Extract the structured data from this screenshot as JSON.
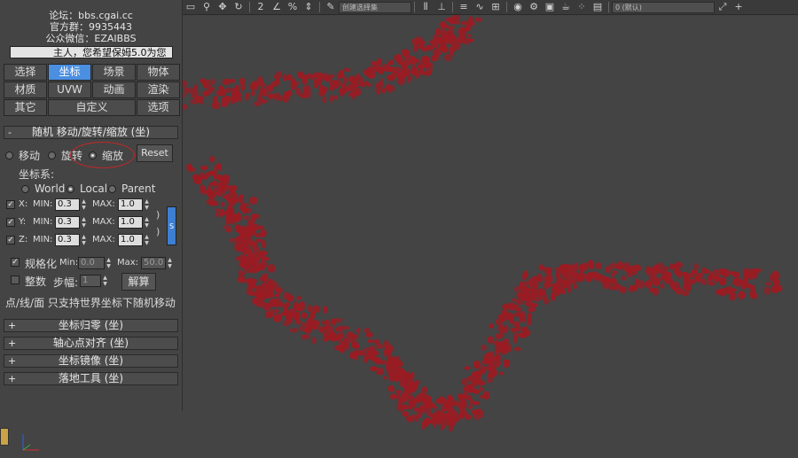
{
  "header": {
    "forum": "论坛：bbs.cgai.cc",
    "qq_group": "官方群：9935443",
    "wechat": "公众微信：EZAIBBS",
    "notice": "主人，您希望保姆5.0为您"
  },
  "tabs": [
    {
      "label": "选择",
      "active": false
    },
    {
      "label": "坐标",
      "active": true
    },
    {
      "label": "场景",
      "active": false
    },
    {
      "label": "物体",
      "active": false
    },
    {
      "label": "材质",
      "active": false
    },
    {
      "label": "UVW",
      "active": false
    },
    {
      "label": "动画",
      "active": false
    },
    {
      "label": "渲染",
      "active": false
    },
    {
      "label": "其它",
      "active": false
    },
    {
      "label": "自定义",
      "active": false
    },
    {
      "label": "选项",
      "active": false
    }
  ],
  "random_rollout": {
    "sign": "-",
    "title": "随机 移动/旋转/缩放 (坐)",
    "modes": [
      {
        "label": "移动",
        "selected": false
      },
      {
        "label": "旋转",
        "selected": false
      },
      {
        "label": "缩放",
        "selected": true
      }
    ],
    "reset_label": "Reset",
    "coord_label": "坐标系:",
    "coord_options": [
      {
        "label": "World",
        "selected": false
      },
      {
        "label": "Local",
        "selected": true
      },
      {
        "label": "Parent",
        "selected": false
      }
    ],
    "axes": [
      {
        "axis": "X:",
        "checked": true,
        "min_label": "MIN:",
        "min": "0.3",
        "max_label": "MAX:",
        "max": "1.0"
      },
      {
        "axis": "Y:",
        "checked": true,
        "min_label": "MIN:",
        "min": "0.3",
        "max_label": "MAX:",
        "max": "1.0"
      },
      {
        "axis": "Z:",
        "checked": true,
        "min_label": "MIN:",
        "min": "0.3",
        "max_label": "MAX:",
        "max": "1.0"
      }
    ],
    "side_button": "S",
    "normalize": {
      "label": "规格化",
      "checked": true,
      "min_label": "Min:",
      "min": "0.0",
      "max_label": "Max:",
      "max": "50.0"
    },
    "integer": {
      "label": "整数",
      "checked": false,
      "step_label": "步幅:",
      "step": "1"
    },
    "solve_label": "解算",
    "note": "点/线/面 只支持世界坐标下随机移动"
  },
  "other_rollouts": [
    {
      "sign": "+",
      "title": "坐标归零 (坐)"
    },
    {
      "sign": "+",
      "title": "轴心点对齐 (坐)"
    },
    {
      "sign": "+",
      "title": "坐标镜像 (坐)"
    },
    {
      "sign": "+",
      "title": "落地工具 (坐)"
    }
  ],
  "toolbar": {
    "selection_set_placeholder": "创建选择集",
    "layer_name": "0 (默认)",
    "icons": [
      "window-icon",
      "link-icon",
      "move-icon",
      "rotate-icon",
      "scale-icon",
      "snap-2-icon",
      "angle-snap-icon",
      "percent-snap-icon",
      "spinner-snap-icon",
      "edit-named-selection-icon",
      "mirror-icon",
      "align-icon",
      "layer-icon",
      "curve-editor-icon",
      "schematic-icon",
      "material-editor-icon",
      "render-setup-icon",
      "render-frame-icon",
      "render-icon",
      "teapot-icon",
      "particle-icon",
      "add-icon"
    ]
  },
  "viewport": {
    "background": "#444444",
    "petal_color": "#9a1c23",
    "axis_colors": {
      "x": "#d03030",
      "y": "#30b040",
      "z": "#3060e0"
    }
  }
}
